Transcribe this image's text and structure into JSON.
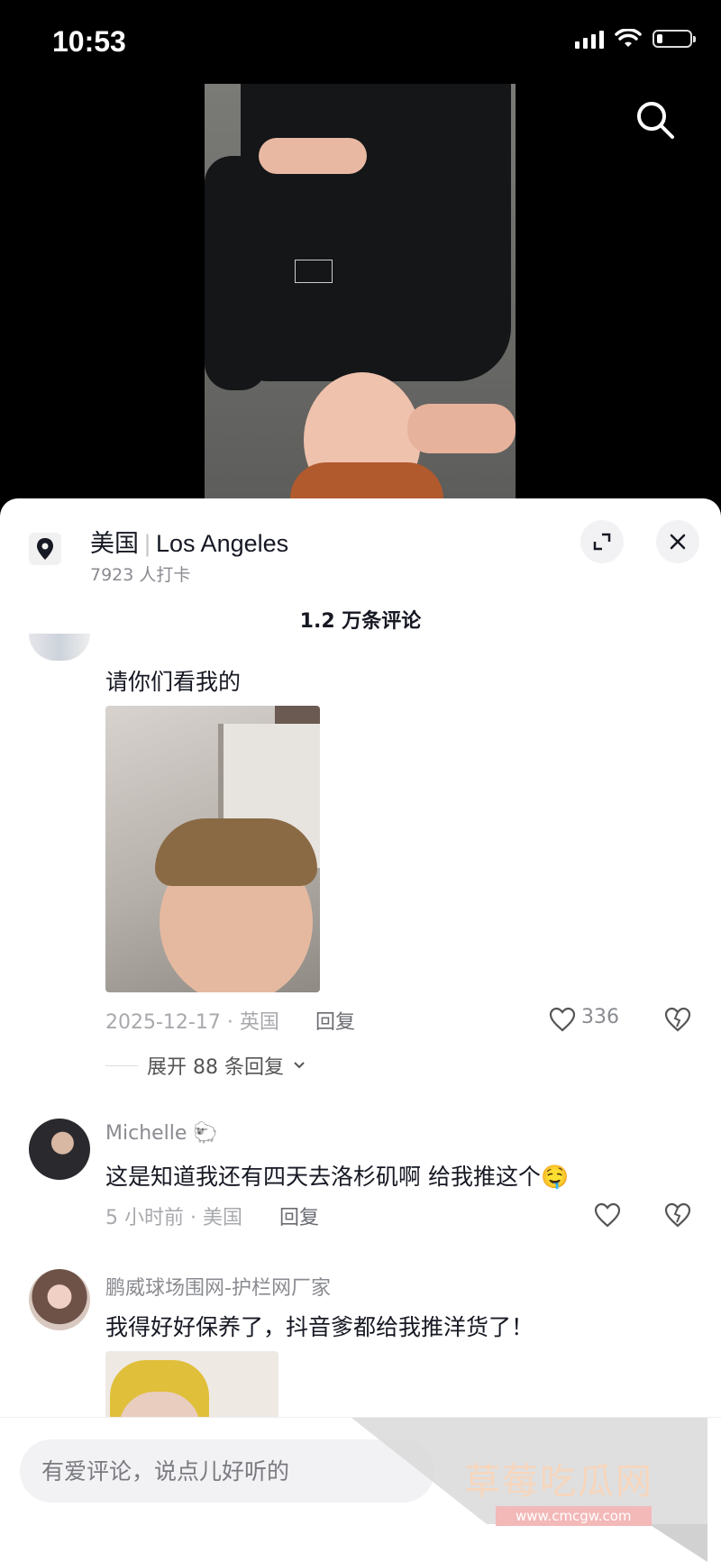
{
  "status_bar": {
    "time": "10:53"
  },
  "location": {
    "country": "美国",
    "city": "Los Angeles",
    "checkins": "7923 人打卡"
  },
  "comments_header": "1.2 万条评论",
  "comments": [
    {
      "text": "请你们看我的",
      "meta": "2025-12-17 · 英国",
      "reply": "回复",
      "likes": "336",
      "expand": "展开 88 条回复"
    },
    {
      "name": "Michelle 🐑",
      "text": "这是知道我还有四天去洛杉矶啊 给我推这个🤤",
      "meta": "5 小时前 · 美国",
      "reply": "回复"
    },
    {
      "name": "鹏威球场围网-护栏网厂家",
      "text": "我得好好保养了，抖音爹都给我推洋货了！"
    }
  ],
  "input": {
    "placeholder": "有爱评论，说点儿好听的"
  },
  "watermark": {
    "title": "草莓吃瓜网",
    "url": "www.cmcgw.com"
  },
  "colors": {
    "accent_text": "#161823",
    "muted": "#8a8b91",
    "watermark": "#f6d6bd"
  }
}
